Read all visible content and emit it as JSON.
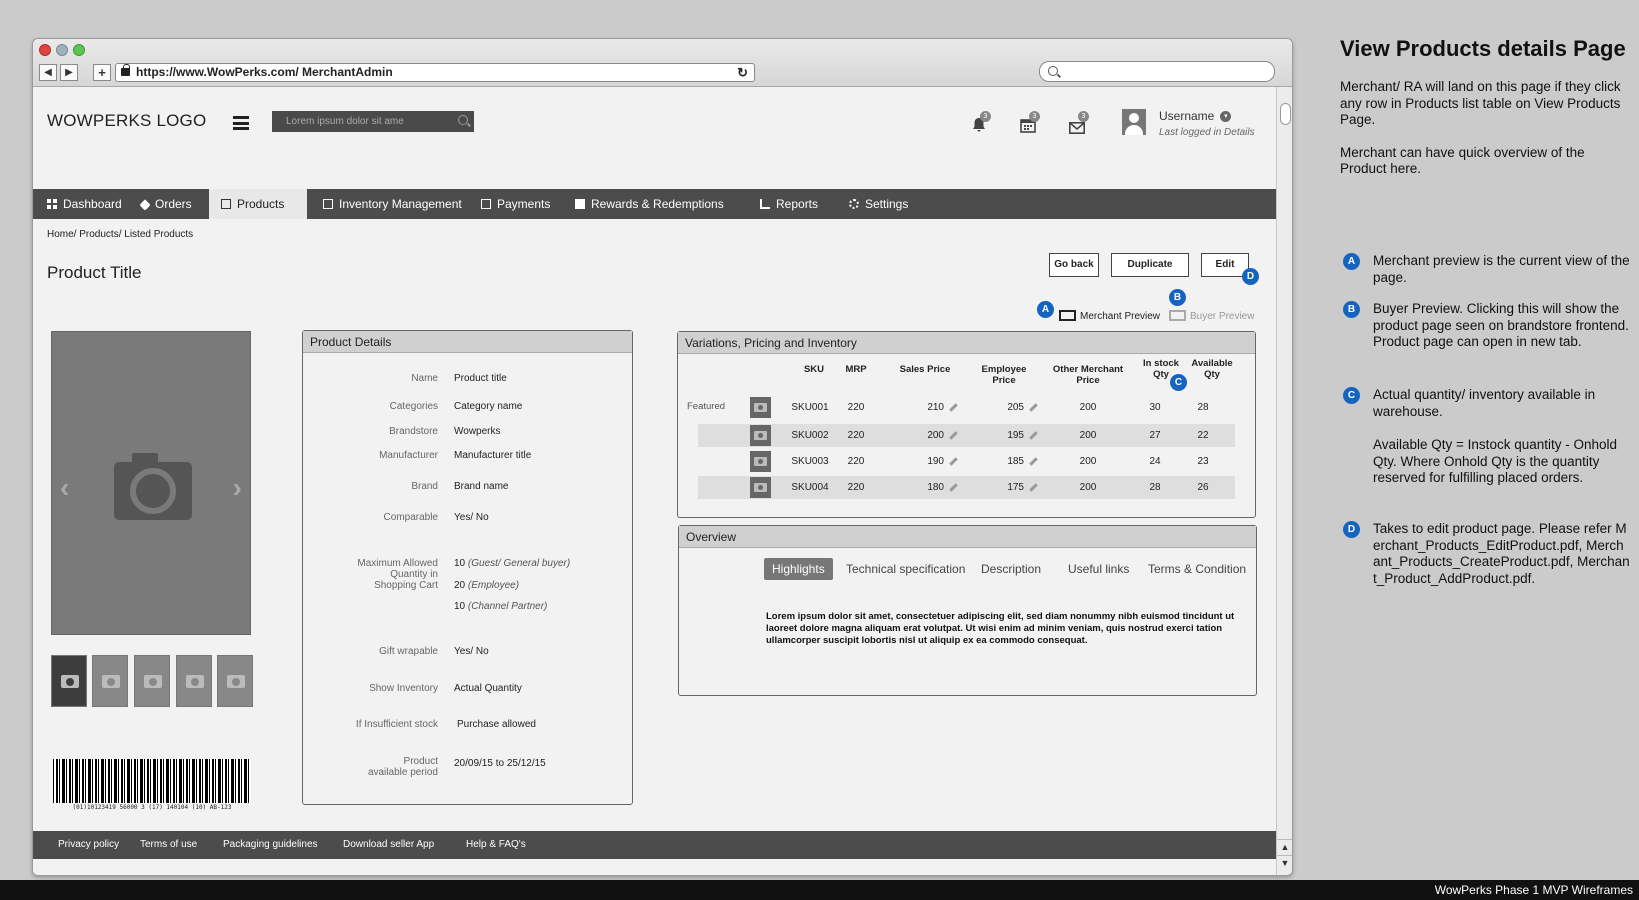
{
  "browser": {
    "url": "https://www.WowPerks.com/ MerchantAdmin",
    "back": "◀",
    "forward": "▶",
    "new_tab": "+",
    "reload": "↻"
  },
  "header": {
    "logo": "WOWPERKS LOGO",
    "search_placeholder": "Lorem ipsum dolor sit ame",
    "notification_badge": "3",
    "calendar_badge": "3",
    "mail_badge": "3",
    "username": "Username",
    "caret": "▾",
    "last_logged": "Last logged in Details"
  },
  "nav": {
    "items": [
      {
        "label": "Dashboard",
        "icon": "dashboard-icon"
      },
      {
        "label": "Orders",
        "icon": "tag-icon"
      },
      {
        "label": "Products",
        "icon": "box-icon"
      },
      {
        "label": "Inventory Management",
        "icon": "inventory-icon"
      },
      {
        "label": "Payments",
        "icon": "payments-icon"
      },
      {
        "label": "Rewards & Redemptions",
        "icon": "gift-icon"
      },
      {
        "label": "Reports",
        "icon": "chart-icon"
      },
      {
        "label": "Settings",
        "icon": "gear-icon"
      }
    ],
    "active": "Products"
  },
  "breadcrumb": "Home/ Products/ Listed Products",
  "page_title": "Product Title",
  "actions": {
    "go_back": "Go back",
    "duplicate": "Duplicate",
    "edit": "Edit"
  },
  "preview": {
    "merchant": "Merchant Preview",
    "buyer": "Buyer Preview"
  },
  "markers": {
    "a": "A",
    "b": "B",
    "c": "C",
    "d": "D"
  },
  "gallery": {
    "prev": "‹",
    "next": "›",
    "barcode_text": "(01)10123419 56000 3 (17) 140104 (10) AB-123"
  },
  "product_details": {
    "title": "Product Details",
    "rows": {
      "name": {
        "label": "Name",
        "value": "Product title"
      },
      "categories": {
        "label": "Categories",
        "value": "Category name"
      },
      "brandstore": {
        "label": "Brandstore",
        "value": "Wowperks"
      },
      "manufacturer": {
        "label": "Manufacturer",
        "value": "Manufacturer title"
      },
      "brand": {
        "label": "Brand",
        "value": "Brand name"
      },
      "comparable": {
        "label": "Comparable",
        "value": "Yes/ No"
      },
      "max_qty": {
        "label": "Maximum Allowed Quantity in Shopping Cart",
        "values": [
          {
            "qty": "10",
            "who": "(Guest/ General buyer)"
          },
          {
            "qty": "20",
            "who": "(Employee)"
          },
          {
            "qty": "10",
            "who": "(Channel Partner)"
          }
        ]
      },
      "gift": {
        "label": "Gift wrapable",
        "value": "Yes/ No"
      },
      "inventory": {
        "label": "Show Inventory",
        "value": "Actual Quantity"
      },
      "insufficient": {
        "label": "If Insufficient stock",
        "value": "Purchase allowed"
      },
      "period": {
        "label": "Product available period",
        "value": "20/09/15 to 25/12/15"
      }
    }
  },
  "variations": {
    "title": "Variations, Pricing and Inventory",
    "featured_label": "Featured",
    "columns": {
      "sku": "SKU",
      "mrp": "MRP",
      "sales": "Sales Price",
      "employee": "Employee Price",
      "other": "Other Merchant Price",
      "instock": "In stock Qty",
      "available": "Available Qty"
    },
    "rows": [
      {
        "sku": "SKU001",
        "mrp": "220",
        "sales": "210",
        "employee": "205",
        "other": "200",
        "instock": "30",
        "available": "28"
      },
      {
        "sku": "SKU002",
        "mrp": "220",
        "sales": "200",
        "employee": "195",
        "other": "200",
        "instock": "27",
        "available": "22"
      },
      {
        "sku": "SKU003",
        "mrp": "220",
        "sales": "190",
        "employee": "185",
        "other": "200",
        "instock": "24",
        "available": "23"
      },
      {
        "sku": "SKU004",
        "mrp": "220",
        "sales": "180",
        "employee": "175",
        "other": "200",
        "instock": "28",
        "available": "26"
      }
    ]
  },
  "overview": {
    "title": "Overview",
    "tabs": [
      "Highlights",
      "Technical specification",
      "Description",
      "Useful links",
      "Terms & Condition"
    ],
    "active_tab": "Highlights",
    "body": "Lorem ipsum dolor sit amet, consectetuer adipiscing elit, sed diam nonummy nibh euismod tincidunt ut laoreet dolore magna aliquam erat volutpat. Ut wisi enim ad minim veniam, quis nostrud exerci tation ullamcorper suscipit lobortis nisl ut aliquip ex ea commodo consequat."
  },
  "footer": {
    "links": [
      "Privacy policy",
      "Terms of use",
      "Packaging guidelines",
      "Download seller App",
      "Help & FAQ's"
    ]
  },
  "scroll": {
    "up": "▲",
    "down": "▼"
  },
  "notes": {
    "title": "View Products details Page",
    "p1": "Merchant/ RA will land on this page if they click any row in Products list table on View Products Page.",
    "p2": "Merchant can have quick overview of the Product here.",
    "a": "Merchant preview is the current view of the page.",
    "b": "Buyer Preview. Clicking this will show the product page seen on brandstore frontend. Product page can open in new tab.",
    "c1": "Actual quantity/ inventory available in warehouse.",
    "c2": "Available Qty = Instock quantity - Onhold Qty. Where Onhold Qty is the quantity reserved for fulfilling placed orders.",
    "d": "Takes to edit product page. Please refer Merchant_Products_EditProduct.pdf, Merchant_Products_CreateProduct.pdf, Merchant_Product_AddProduct.pdf."
  },
  "bottom_caption": "WowPerks Phase 1 MVP Wireframes"
}
